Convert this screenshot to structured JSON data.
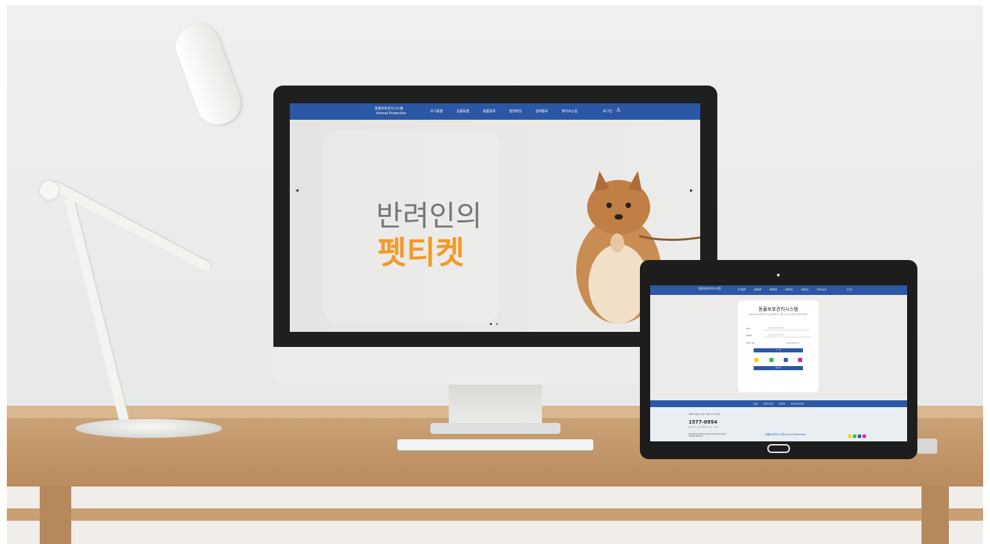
{
  "monitor": {
    "logo_title": "동물보호관리시스템",
    "logo_sub": "Animal Protection",
    "menu": [
      "유기동물",
      "실종동물",
      "동물등록",
      "분양마당",
      "광쾌홍보",
      "찾아오는길"
    ],
    "login": "로그인",
    "hero_line1": "반려인의",
    "hero_line2": "펫티켓",
    "prev": "◀",
    "next": "▶"
  },
  "tablet": {
    "logo_title": "동물보호관리시스템",
    "logo_sub": "Animal Protection",
    "menu": [
      "유기동물",
      "실종동물",
      "동물등록",
      "분양마당",
      "광쾌홍보",
      "찾아오는길"
    ],
    "login": "로그인",
    "login_title": "동물보호관리시스템",
    "login_desc": "동물보호관리시스템에 오신 것을 환영합니다. 회원 로그인 후 서비스를 이용해 주세요.",
    "id_label": "아이디",
    "id_placeholder": "아이디를 입력해 주세요",
    "pw_label": "비밀번호",
    "pw_placeholder": "비밀번호를 입력하세요",
    "remember": "아이디 저장",
    "find": "아이디/비밀번호 찾기",
    "login_button": "로 그 인",
    "join_button": "회원가입",
    "footer_menu": [
      "도움말",
      "개인정보방침",
      "이용약관",
      "영상정보처리방침"
    ],
    "address": "(39660) 경상북도 김천시 혁신8로 177 농림축산",
    "tel": "1577-0954",
    "hours": "평일 09:00 ~ 18:00 (점심시간 12:00 ~ 13:00)",
    "copyright1": "Copyright by Animal and Plant Quarantine Agency.",
    "copyright2": "All Rights Reserved.",
    "footer_logo": "동물보호관리시스템 Animal Protection"
  }
}
